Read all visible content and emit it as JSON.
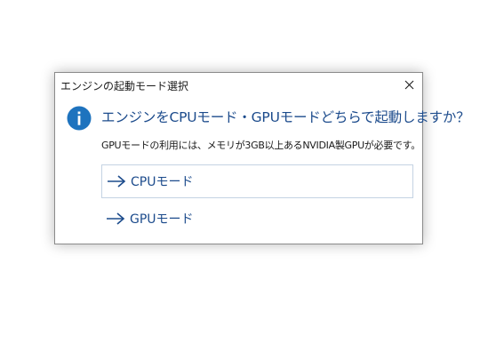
{
  "dialog": {
    "title": "エンジンの起動モード選択",
    "close_icon": "close-icon",
    "info_icon": "info-icon",
    "main_instruction": "エンジンをCPUモード・GPUモードどちらで起動しますか？",
    "content": "GPUモードの利用には、メモリが3GB以上あるNVIDIA製GPUが必要です。",
    "options": [
      {
        "label": "CPUモード",
        "icon": "arrow-right-icon",
        "focused": true
      },
      {
        "label": "GPUモード",
        "icon": "arrow-right-icon",
        "focused": false
      }
    ]
  },
  "colors": {
    "accent": "#1c4b8c",
    "info_icon_bg": "#1e73be",
    "focus_border": "#c4d3e3"
  }
}
